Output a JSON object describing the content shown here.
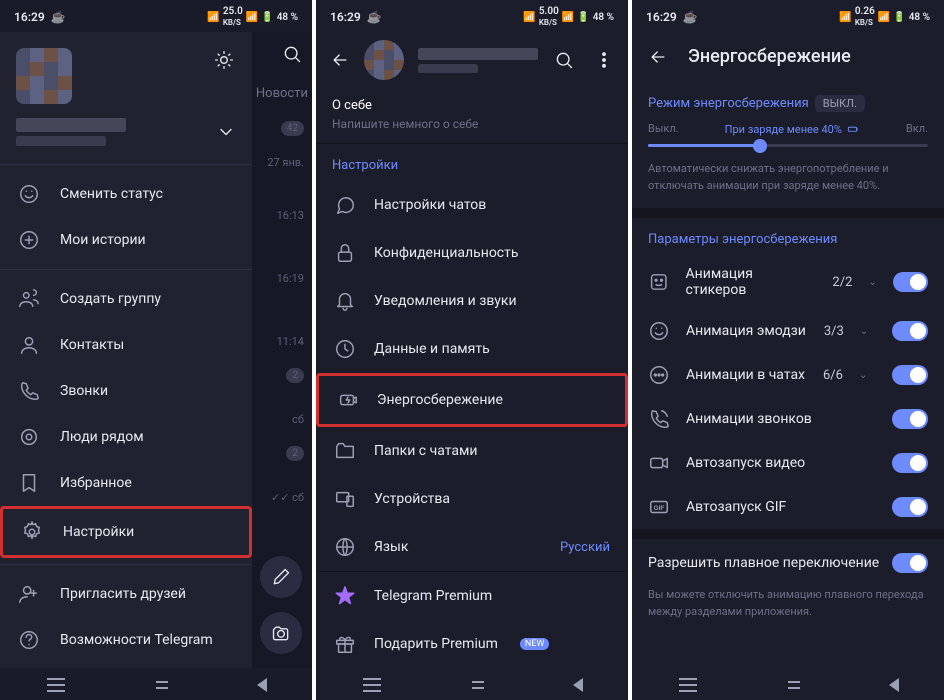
{
  "status": {
    "time": "16:29",
    "kb1": "25.0",
    "kb2": "5.00",
    "kb3": "0.26",
    "kbunit": "KB/S",
    "battery": "48 %"
  },
  "phone1": {
    "menu": {
      "change_status": "Сменить статус",
      "my_stories": "Мои истории",
      "create_group": "Создать группу",
      "contacts": "Контакты",
      "calls": "Звонки",
      "people_nearby": "Люди рядом",
      "saved": "Избранное",
      "settings": "Настройки",
      "invite": "Пригласить друзей",
      "features": "Возможности Telegram"
    },
    "side": {
      "news": "Новости",
      "badge1": "42",
      "date1": "27 янв.",
      "time1": "16:13",
      "time2": "16:19",
      "time3": "11:14",
      "badge2": "2",
      "sat": "сб",
      "badge3": "2",
      "sat2": "сб"
    }
  },
  "phone2": {
    "about_title": "О себе",
    "about_hint": "Напишите немного о себе",
    "settings_header": "Настройки",
    "items": {
      "chat": "Настройки чатов",
      "privacy": "Конфиденциальность",
      "notifications": "Уведомления и звуки",
      "data": "Данные и память",
      "power": "Энергосбережение",
      "folders": "Папки с чатами",
      "devices": "Устройства",
      "language": "Язык",
      "language_val": "Русский",
      "premium": "Telegram Premium",
      "gift": "Подарить Premium",
      "new_badge": "NEW"
    }
  },
  "phone3": {
    "title": "Энергосбережение",
    "mode_label": "Режим энергосбережения",
    "mode_state": "ВЫКЛ.",
    "off": "Выкл.",
    "when": "При заряде менее 40%",
    "on": "Вкл.",
    "hint": "Автоматически снижать энергопотребление и отключать анимации при заряде менее 40%.",
    "params_header": "Параметры энергосбережения",
    "items": {
      "stickers": "Анимация стикеров",
      "stickers_c": "2/2",
      "emoji": "Анимация эмодзи",
      "emoji_c": "3/3",
      "chat_anim": "Анимации в чатах",
      "chat_c": "6/6",
      "calls": "Анимации звонков",
      "autovideo": "Автозапуск видео",
      "autogif": "Автозапуск GIF"
    },
    "smooth": "Разрешить плавное переключение",
    "smooth_hint": "Вы можете отключить анимацию плавного перехода между разделами приложения."
  }
}
